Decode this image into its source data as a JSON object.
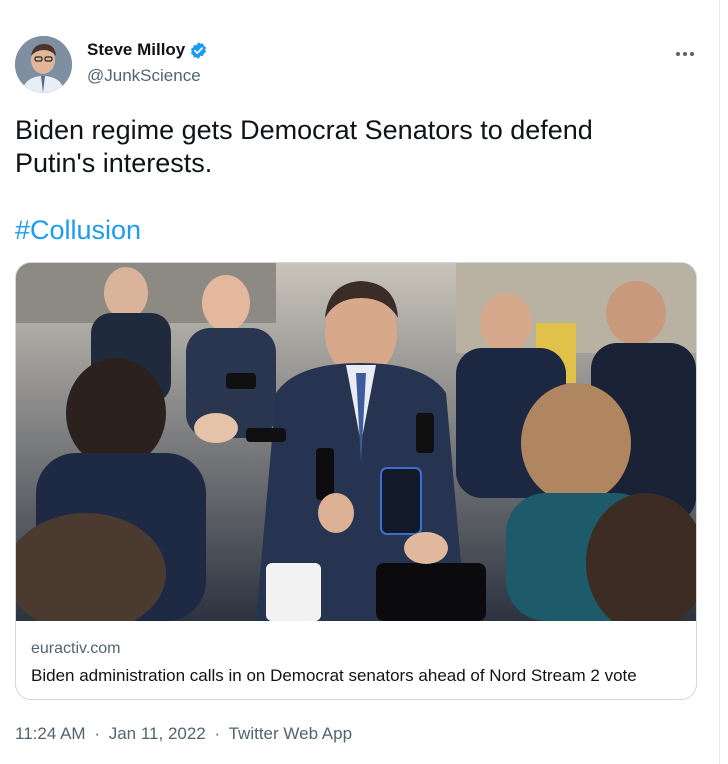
{
  "author": {
    "display_name": "Steve Milloy",
    "handle": "@JunkScience",
    "verified": true
  },
  "tweet": {
    "text": "Biden regime gets Democrat Senators to defend Putin's interests.",
    "hashtag": "#Collusion"
  },
  "link_card": {
    "domain": "euractiv.com",
    "title": "Biden administration calls in on Democrat senators ahead of Nord Stream 2 vote"
  },
  "meta": {
    "time": "11:24 AM",
    "date": "Jan 11, 2022",
    "source": "Twitter Web App",
    "separator": "·"
  },
  "icons": {
    "verified": "verified-badge-icon",
    "more": "more-options-icon"
  },
  "colors": {
    "link": "#1d9bf0",
    "secondary_text": "#536471",
    "border": "#cfd9de"
  }
}
